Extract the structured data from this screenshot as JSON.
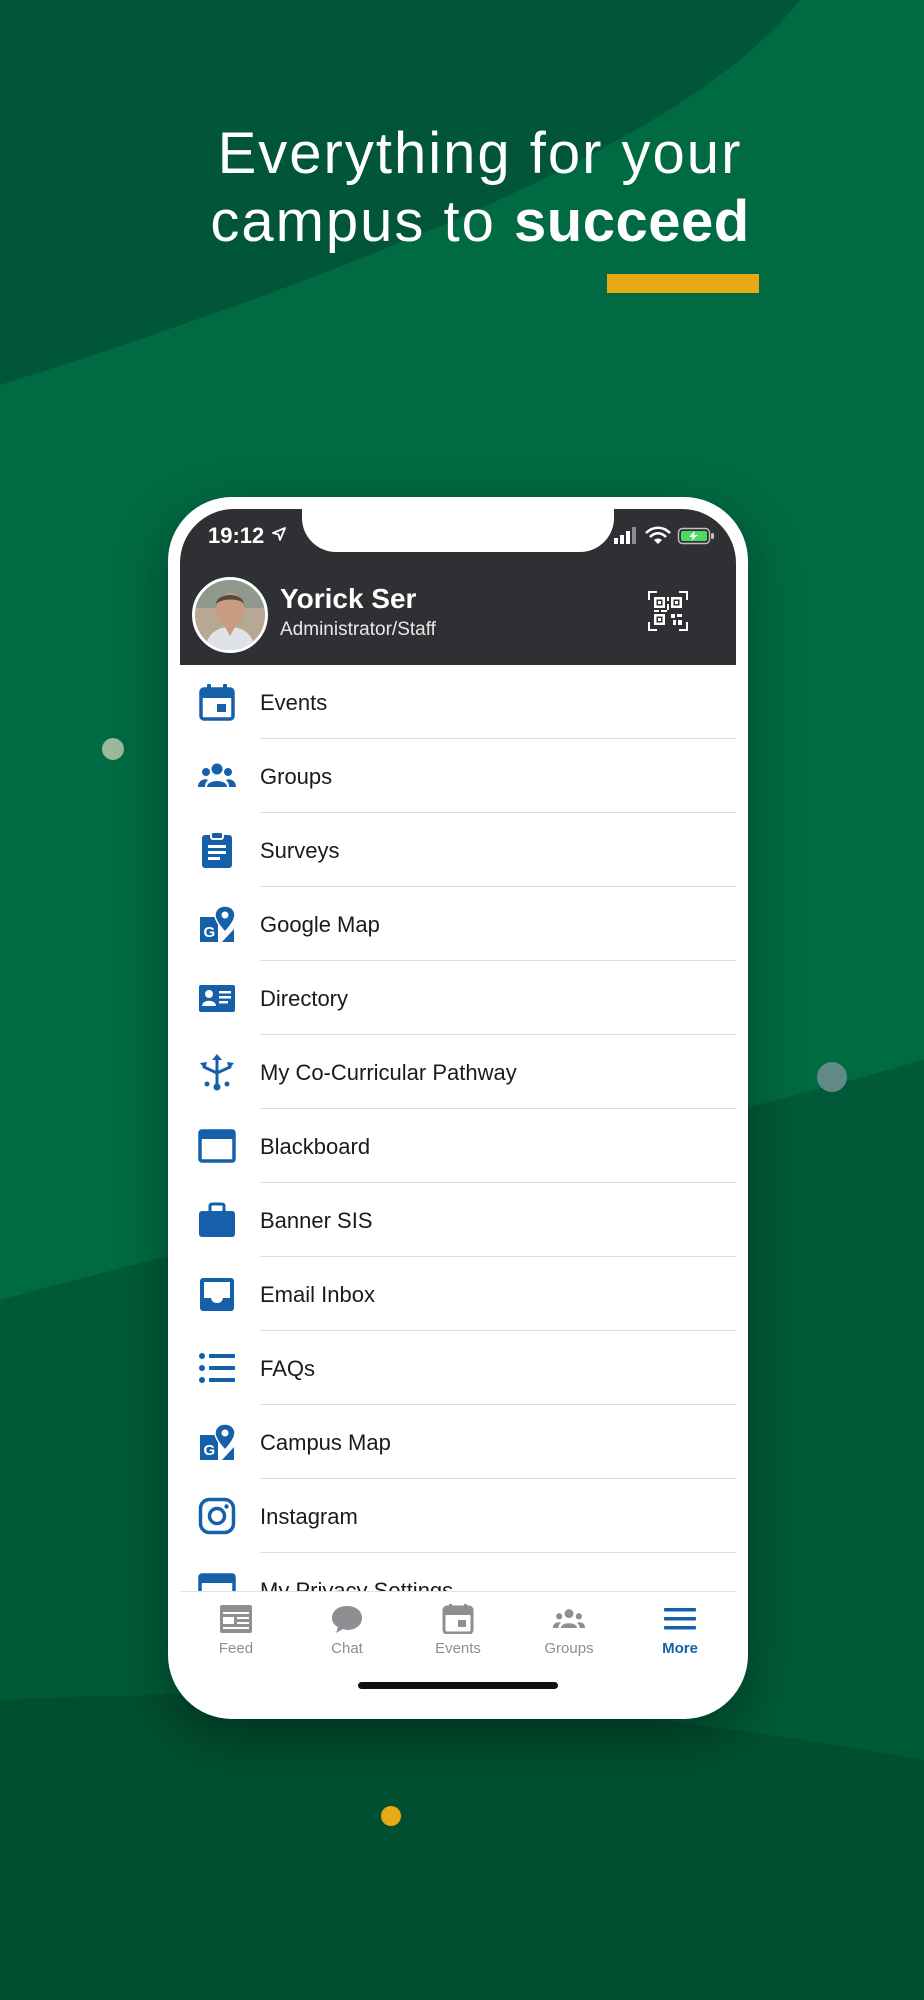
{
  "colors": {
    "background": "#006840",
    "accent_yellow": "#E8AA14",
    "header_dark": "#2F3033",
    "icon_blue": "#1560A8",
    "tab_inactive": "#8e8e93"
  },
  "headline": {
    "line1": "Everything for your",
    "line2_prefix": "campus to",
    "line2_strong": "succeed"
  },
  "status_bar": {
    "time": "19:12"
  },
  "profile": {
    "name": "Yorick Ser",
    "role": "Administrator/Staff"
  },
  "menu": {
    "items": [
      {
        "label": "Events",
        "icon": "calendar-icon"
      },
      {
        "label": "Groups",
        "icon": "groups-icon"
      },
      {
        "label": "Surveys",
        "icon": "clipboard-icon"
      },
      {
        "label": "Google Map",
        "icon": "map-pin-icon"
      },
      {
        "label": "Directory",
        "icon": "id-card-icon"
      },
      {
        "label": "My Co-Curricular Pathway",
        "icon": "pathway-arrows-icon"
      },
      {
        "label": "Blackboard",
        "icon": "browser-window-icon"
      },
      {
        "label": "Banner SIS",
        "icon": "briefcase-icon"
      },
      {
        "label": "Email Inbox",
        "icon": "inbox-icon"
      },
      {
        "label": "FAQs",
        "icon": "list-icon"
      },
      {
        "label": "Campus Map",
        "icon": "map-pin-icon"
      },
      {
        "label": "Instagram",
        "icon": "instagram-icon"
      },
      {
        "label": "My Privacy Settings",
        "icon": "browser-window-icon"
      }
    ]
  },
  "tabbar": {
    "tabs": [
      {
        "label": "Feed",
        "icon": "feed-icon",
        "active": false
      },
      {
        "label": "Chat",
        "icon": "chat-bubble-icon",
        "active": false
      },
      {
        "label": "Events",
        "icon": "calendar-icon",
        "active": false
      },
      {
        "label": "Groups",
        "icon": "groups-icon",
        "active": false
      },
      {
        "label": "More",
        "icon": "hamburger-menu-icon",
        "active": true
      }
    ]
  }
}
